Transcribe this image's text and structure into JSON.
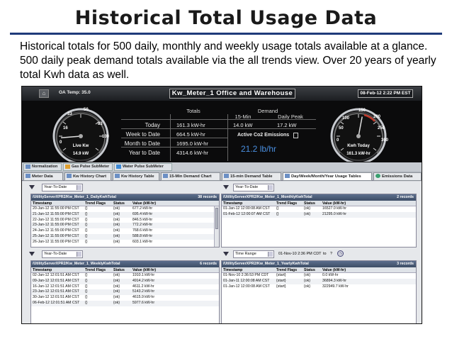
{
  "slide": {
    "title": "Historical Total Usage Data",
    "body": "Historical totals for 500 daily, monthly and weekly usage totals available at a glance. 500 daily peak demand totals available via the all trends view. Over 20 years of yearly total Kwh data as well."
  },
  "app": {
    "oa_temp": "OA Temp: 35.0",
    "meter_title": "Kw_Meter_1 Office and Warehouse",
    "datetime": "08-Feb-12 2:22 PM EST",
    "home_icon": "home-icon",
    "gauge_left": {
      "ticks": [
        "16",
        "33",
        "50",
        "83",
        "100",
        "0"
      ],
      "label": "Live Kw",
      "value": "14.9 kW",
      "needle_fraction": 0.15
    },
    "gauge_right": {
      "ticks": [
        "50",
        "100",
        "150",
        "200",
        "250",
        "300",
        "0"
      ],
      "label": "Kwh Today",
      "value": "161.3 kW-hr",
      "needle_fraction": 0.54
    },
    "totals": {
      "header": "Totals",
      "demand_header": "Demand",
      "min15_header": "15-Min",
      "daily_peak_header": "Daily Peak",
      "rows": [
        {
          "label": "Today",
          "value": "161.3 kW-hr"
        },
        {
          "label": "Week to Date",
          "value": "664.5 kW-hr"
        },
        {
          "label": "Month to Date",
          "value": "1695.0 kW-hr"
        },
        {
          "label": "Year to Date",
          "value": "4314.6 kW-hr"
        }
      ],
      "min15_value": "14.0 kW",
      "daily_peak_value": "17.2 kW"
    },
    "co2": {
      "label": "Active Co2 Emissions",
      "value": "21.2 lb/hr",
      "icon": "document-icon"
    },
    "submeter_tabs": [
      "Normalization",
      "Gas Pulse SubMeter",
      "Water Pulse SubMeter"
    ],
    "main_tabs": [
      "Meter Data",
      "Kw History Chart",
      "Kw History Table",
      "15-Min Demand Chart",
      "15-min Demand Table",
      "Day/Week/Month/Year Usage Tables",
      "Emissions Data"
    ],
    "active_tab": "Day/Week/Month/Year Usage Tables",
    "selectors": {
      "top_left": "Year-To-Date",
      "top_right": "Year-To-Date",
      "bottom_left": "Year-To-Date",
      "bottom_right": "Time Range",
      "bottom_right_range": "01-Nov-10 2:36 PM CDT",
      "bottom_right_to": "to",
      "bottom_right_end": "?",
      "clock_icon": "clock-icon"
    },
    "columns": [
      "Timestamp",
      "Trend Flags",
      "Status",
      "Value (kW-hr)"
    ],
    "panels": {
      "daily": {
        "title": "/UtilityServerXPR2/Kw_Meter_1_DailyKwhTotal",
        "count": "38 records",
        "rows": [
          [
            "20-Jan-12 11:55:00 PM CST",
            "{}",
            "{ok}",
            "677.2 kW-hr"
          ],
          [
            "21-Jan-12 11:55:00 PM CST",
            "{}",
            "{ok}",
            "695.4 kW-hr"
          ],
          [
            "22-Jan-12 11:55:00 PM CST",
            "{}",
            "{ok}",
            "846.5 kW-hr"
          ],
          [
            "23-Jan-12 11:55:00 PM CST",
            "{}",
            "{ok}",
            "772.2 kW-hr"
          ],
          [
            "24-Jan-12 11:55:00 PM CST",
            "{}",
            "{ok}",
            "768.6 kW-hr"
          ],
          [
            "25-Jan-12 11:55:00 PM CST",
            "{}",
            "{ok}",
            "588.8 kW-hr"
          ],
          [
            "26-Jan-12 11:55:00 PM CST",
            "{}",
            "{ok}",
            "603.1 kW-hr"
          ]
        ]
      },
      "monthly": {
        "title": "/UtilityServerXPR2/Kw_Meter_1_MonthlyKwhTotal",
        "count": "2 records",
        "rows": [
          [
            "01-Jan-12 12:00:08 AM CST",
            "{}",
            "{ok}",
            "16527.0 kW-hr"
          ],
          [
            "01-Feb-12 12:00:07 AM CST",
            "{}",
            "{ok}",
            "21295.0 kW-hr"
          ]
        ]
      },
      "weekly": {
        "title": "/UtilityServerXPR2/Kw_Meter_1_WeeklyKwhTotal",
        "count": "6 records",
        "rows": [
          [
            "02-Jan-12 12:01:51 AM CST",
            "{}",
            "{ok}",
            "1910.1 kW-hr"
          ],
          [
            "09-Jan-12 12:01:51 AM CST",
            "{}",
            "{ok}",
            "4914.2 kW-hr"
          ],
          [
            "16-Jan-12 12:01:51 AM CST",
            "{}",
            "{ok}",
            "4611.2 kW-hr"
          ],
          [
            "23-Jan-12 12:01:51 AM CST",
            "{}",
            "{ok}",
            "5143.2 kW-hr"
          ],
          [
            "30-Jan-12 12:01:51 AM CST",
            "{}",
            "{ok}",
            "4615.9 kW-hr"
          ],
          [
            "06-Feb-12 12:01:51 AM CST",
            "{}",
            "{ok}",
            "5977.6 kW-hr"
          ]
        ]
      },
      "yearly": {
        "title": "/UtilityServerXPR2/Kw_Meter_1_YearlyKwhTotal",
        "count": "3 records",
        "rows": [
          [
            "01-Nov-10 2:36:53 PM CDT",
            "{start}",
            "{ok}",
            "0.0 kW-hr"
          ],
          [
            "01-Jan-11 12:00:08 AM CST",
            "{start}",
            "{ok}",
            "36894.3 kW-hr"
          ],
          [
            "01-Jan-12 12:00:08 AM CST",
            "{start}",
            "{ok}",
            "322949.7 kW-hr"
          ]
        ]
      }
    }
  }
}
